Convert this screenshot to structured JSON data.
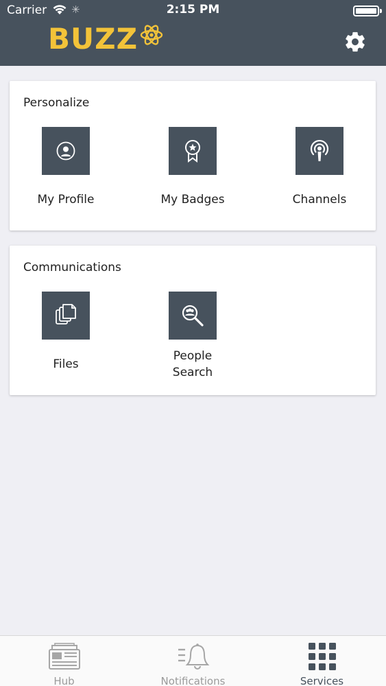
{
  "status_bar": {
    "carrier": "Carrier",
    "time": "2:15 PM"
  },
  "header": {
    "logo_text": "BUZZ",
    "settings_icon": "gear-icon"
  },
  "cards": {
    "personalize": {
      "title": "Personalize",
      "items": [
        {
          "label": "My Profile",
          "icon": "user-icon"
        },
        {
          "label": "My Badges",
          "icon": "badge-icon"
        },
        {
          "label": "Channels",
          "icon": "broadcast-icon"
        }
      ]
    },
    "communications": {
      "title": "Communications",
      "items": [
        {
          "label": "Files",
          "icon": "files-icon"
        },
        {
          "label_line1": "People",
          "label_line2": "Search",
          "icon": "people-search-icon"
        }
      ]
    }
  },
  "tabbar": {
    "tabs": [
      {
        "label": "Hub",
        "icon": "hub-icon",
        "active": false
      },
      {
        "label": "Notifications",
        "icon": "bell-icon",
        "active": false
      },
      {
        "label": "Services",
        "icon": "grid-icon",
        "active": true
      }
    ]
  },
  "colors": {
    "header_bg": "#47525d",
    "logo": "#f3c339",
    "tile_bg": "#47525d",
    "page_bg": "#efeff4"
  }
}
